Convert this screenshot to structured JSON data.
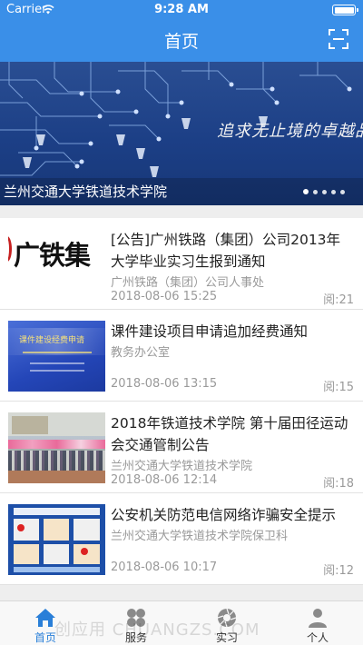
{
  "status": {
    "carrier": "Carrier",
    "time": "9:28 AM"
  },
  "nav": {
    "title": "首页",
    "scan_icon": "scan-icon"
  },
  "banner": {
    "caption": "兰州交通大学铁道技术学院",
    "slogan": "追求无止境的卓越品",
    "dots": 5,
    "active_dot": 0
  },
  "news": [
    {
      "title": "[公告]广州铁路（集团）公司2013年大学毕业实习生报到通知",
      "source": "广州铁路（集团）公司人事处",
      "date": "2018-08-06 15:25",
      "reads": "阅:21",
      "thumb_text": "广铁集"
    },
    {
      "title": "课件建设项目申请追加经费通知",
      "source": "教务办公室",
      "date": "2018-08-06 13:15",
      "reads": "阅:15",
      "thumb_text": "课件建设经费申请"
    },
    {
      "title": "2018年铁道技术学院 第十届田径运动会交通管制公告",
      "source": "兰州交通大学铁道技术学院",
      "date": "2018-08-06 12:14",
      "reads": "阅:18"
    },
    {
      "title": "公安机关防范电信网络诈骗安全提示",
      "source": "兰州交通大学铁道技术学院保卫科",
      "date": "2018-08-06 10:17",
      "reads": "阅:12"
    }
  ],
  "tabs": [
    {
      "label": "首页",
      "icon": "home-icon",
      "active": true
    },
    {
      "label": "服务",
      "icon": "service-icon",
      "active": false
    },
    {
      "label": "实习",
      "icon": "camera-aperture-icon",
      "active": false
    },
    {
      "label": "个人",
      "icon": "person-icon",
      "active": false
    }
  ],
  "watermark": "创应用 CHUANGZS.COM",
  "colors": {
    "primary": "#3a8fe8",
    "tab_active": "#2a7fd8"
  }
}
